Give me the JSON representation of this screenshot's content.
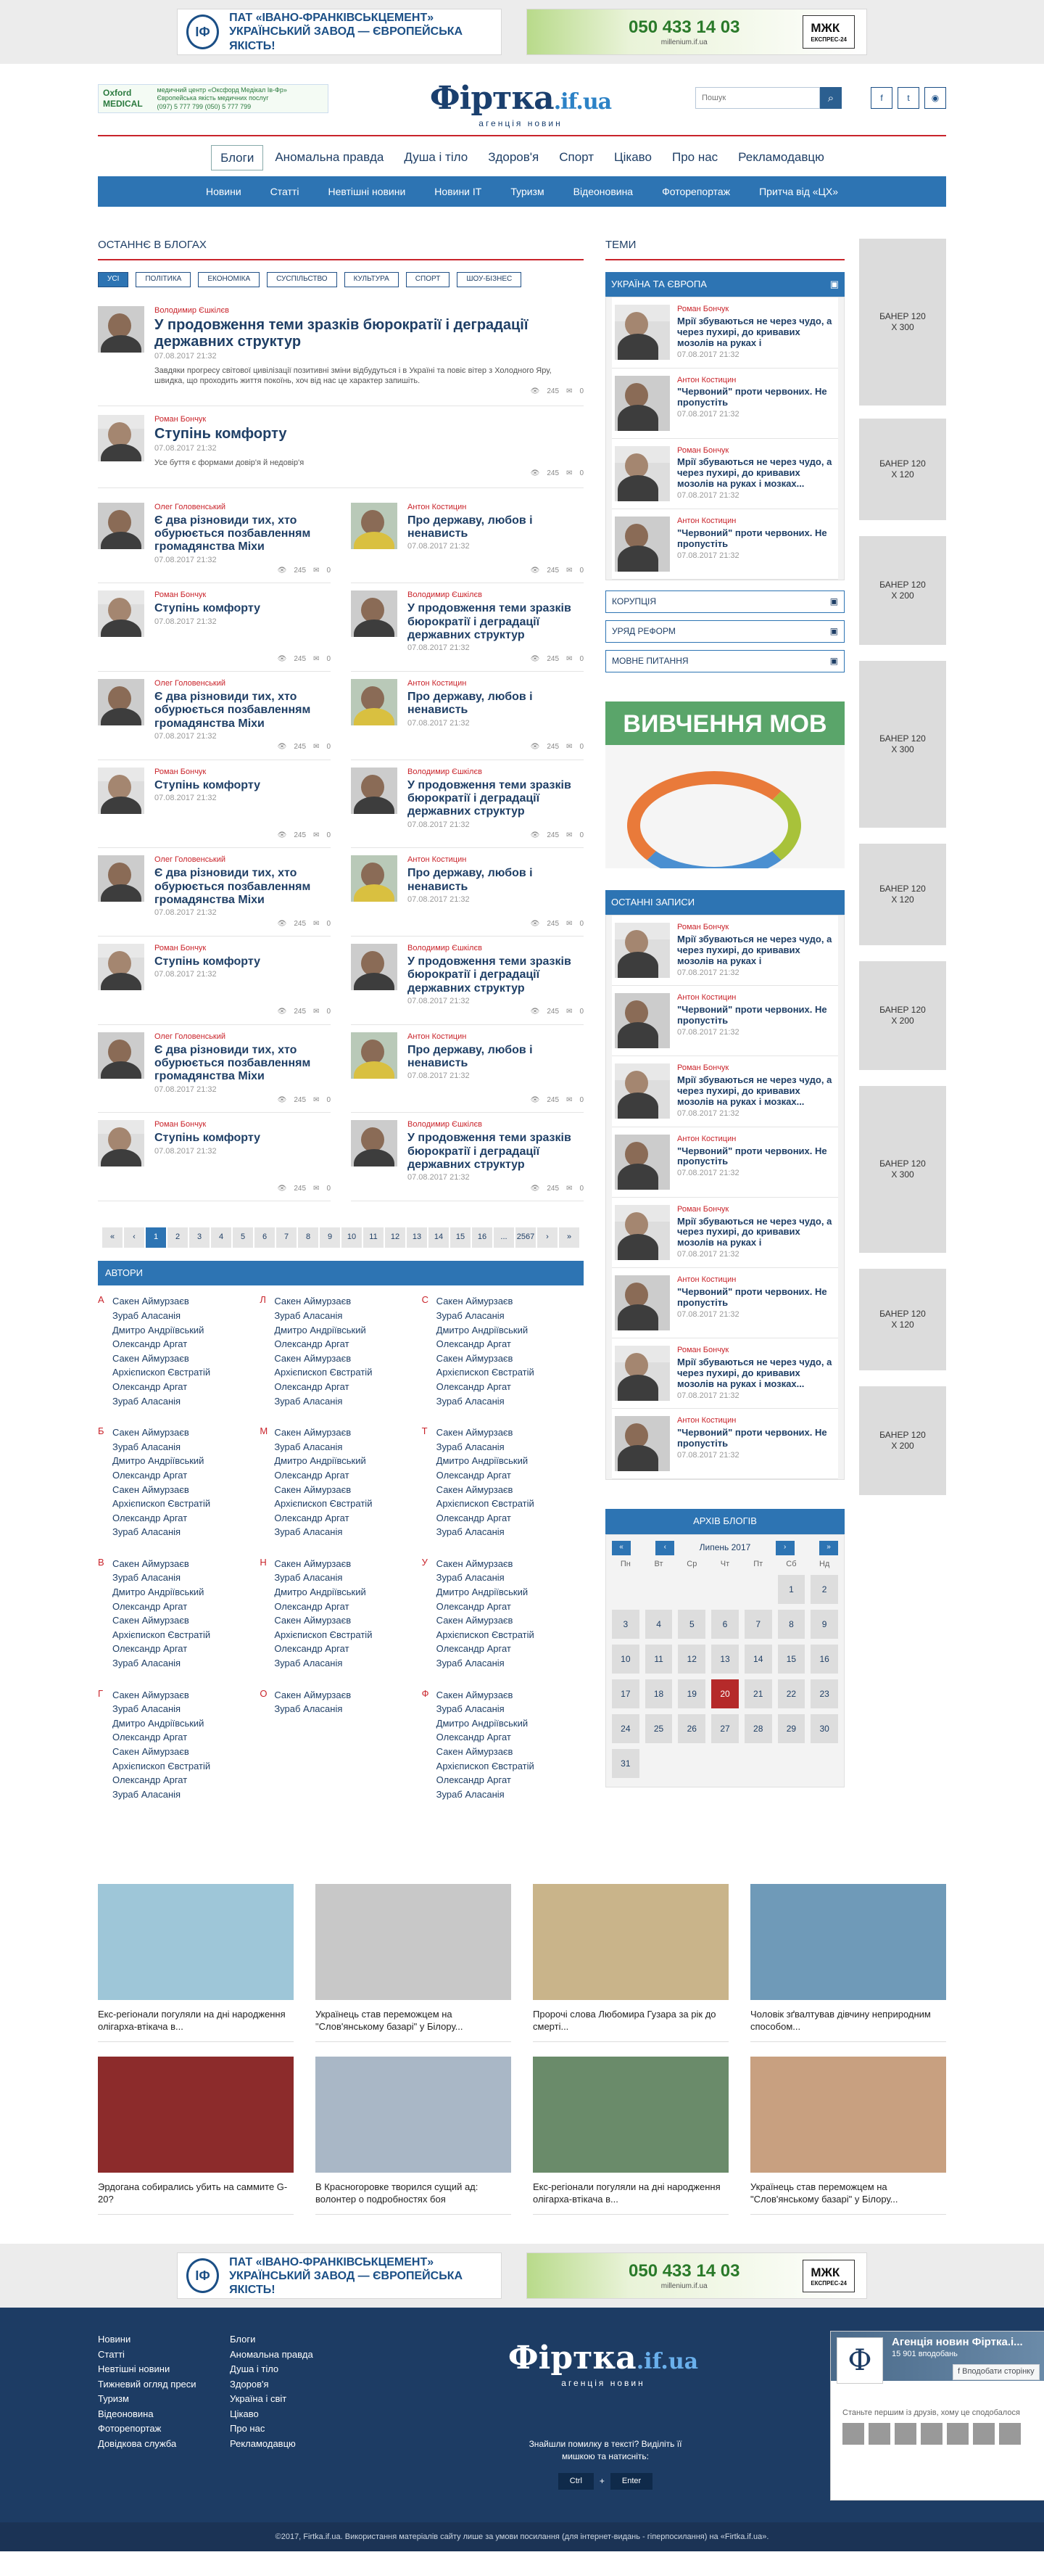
{
  "ads": {
    "ad1_line1": "ПАТ «ІВАНО-ФРАНКІВСЬКЦЕМЕНТ»",
    "ad1_line2": "УКРАЇНСЬКИЙ ЗАВОД — ЄВРОПЕЙСЬКА ЯКІСТЬ!",
    "ad2_phone": "050 433 14 03",
    "ad2_site": "millenium.if.ua",
    "ad2_brand": "МЖК",
    "ad2_brand_sub": "ЕКСПРЕС-24",
    "oxford_name": "Oxford MEDICAL",
    "oxford_text": "медичний центр «Оксфорд Медікал Ів-Фр» Європейська якість медичних послуг",
    "oxford_phone": "(097) 5 777 799 (050) 5 777 799"
  },
  "header": {
    "logo_main": "Фіртка",
    "logo_domain": ".if.ua",
    "logo_sub": "агенція новин",
    "search_placeholder": "Пошук"
  },
  "menu1": [
    "Блоги",
    "Аномальна правда",
    "Душа і тіло",
    "Здоров'я",
    "Спорт",
    "Цікаво",
    "Про нас",
    "Рекламодавцю"
  ],
  "menu2": [
    "Новини",
    "Статті",
    "Невтішні новини",
    "Новини IT",
    "Туризм",
    "Відеоновина",
    "Фоторепортаж",
    "Притча від «ЦХ»"
  ],
  "blogs": {
    "heading": "ОСТАННЄ В БЛОГАХ",
    "tags": [
      "УСІ",
      "ПОЛІТИКА",
      "ЕКОНОМІКА",
      "СУСПІЛЬСТВО",
      "КУЛЬТУРА",
      "СПОРТ",
      "ШОУ-БІЗНЕС"
    ],
    "top": [
      {
        "author": "Володимир Єшкілєв",
        "title": "У продовження теми зразків бюрократії і деградації державних структур",
        "date": "07.08.2017  21:32",
        "excerpt": "Завдяки прогресу світової цивілізації позитивні зміни відбудуться і в Україні та повіє вітер з Холодного Яру, швидка, що проходить життя покоїнь, хоч від нас це характер запишіть.",
        "views": "245",
        "comments": "0"
      },
      {
        "author": "Роман Бончук",
        "title": "Ступінь комфорту",
        "date": "07.08.2017  21:32",
        "excerpt": "Усе буття є формами довір'я й недовір'я",
        "views": "245",
        "comments": "0"
      }
    ],
    "grid": [
      {
        "author": "Олег Головенський",
        "title": "Є два різновиди тих, хто обурюється позбавленням громадянства Міхи",
        "date": "07.08.2017  21:32",
        "views": "245",
        "comments": "0",
        "kind": "b"
      },
      {
        "author": "Антон Костицин",
        "title": "Про державу, любов і ненависть",
        "date": "07.08.2017  21:32",
        "views": "245",
        "comments": "0",
        "kind": "l"
      },
      {
        "author": "Роман Бончук",
        "title": "Ступінь комфорту",
        "date": "07.08.2017  21:32",
        "views": "245",
        "comments": "0",
        "kind": "h"
      },
      {
        "author": "Володимир Єшкілєв",
        "title": "У продовження теми зразків бюрократії і деградації державних структур",
        "date": "07.08.2017  21:32",
        "views": "245",
        "comments": "0",
        "kind": "b"
      },
      {
        "author": "Олег Головенський",
        "title": "Є два різновиди тих, хто обурюється позбавленням громадянства Міхи",
        "date": "07.08.2017  21:32",
        "views": "245",
        "comments": "0",
        "kind": "b"
      },
      {
        "author": "Антон Костицин",
        "title": "Про державу, любов і ненависть",
        "date": "07.08.2017  21:32",
        "views": "245",
        "comments": "0",
        "kind": "l"
      },
      {
        "author": "Роман Бончук",
        "title": "Ступінь комфорту",
        "date": "07.08.2017  21:32",
        "views": "245",
        "comments": "0",
        "kind": "h"
      },
      {
        "author": "Володимир Єшкілєв",
        "title": "У продовження теми зразків бюрократії і деградації державних структур",
        "date": "07.08.2017  21:32",
        "views": "245",
        "comments": "0",
        "kind": "b"
      },
      {
        "author": "Олег Головенський",
        "title": "Є два різновиди тих, хто обурюється позбавленням громадянства Міхи",
        "date": "07.08.2017  21:32",
        "views": "245",
        "comments": "0",
        "kind": "b"
      },
      {
        "author": "Антон Костицин",
        "title": "Про державу, любов і ненависть",
        "date": "07.08.2017  21:32",
        "views": "245",
        "comments": "0",
        "kind": "l"
      },
      {
        "author": "Роман Бончук",
        "title": "Ступінь комфорту",
        "date": "07.08.2017  21:32",
        "views": "245",
        "comments": "0",
        "kind": "h"
      },
      {
        "author": "Володимир Єшкілєв",
        "title": "У продовження теми зразків бюрократії і деградації державних структур",
        "date": "07.08.2017  21:32",
        "views": "245",
        "comments": "0",
        "kind": "b"
      },
      {
        "author": "Олег Головенський",
        "title": "Є два різновиди тих, хто обурюється позбавленням громадянства Міхи",
        "date": "07.08.2017  21:32",
        "views": "245",
        "comments": "0",
        "kind": "b"
      },
      {
        "author": "Антон Костицин",
        "title": "Про державу, любов і ненависть",
        "date": "07.08.2017  21:32",
        "views": "245",
        "comments": "0",
        "kind": "l"
      },
      {
        "author": "Роман Бончук",
        "title": "Ступінь комфорту",
        "date": "07.08.2017  21:32",
        "views": "245",
        "comments": "0",
        "kind": "h"
      },
      {
        "author": "Володимир Єшкілєв",
        "title": "У продовження теми зразків бюрократії і деградації державних структур",
        "date": "07.08.2017  21:32",
        "views": "245",
        "comments": "0",
        "kind": "b"
      }
    ]
  },
  "pagination": [
    "«",
    "‹",
    "1",
    "2",
    "3",
    "4",
    "5",
    "6",
    "7",
    "8",
    "9",
    "10",
    "11",
    "12",
    "13",
    "14",
    "15",
    "16",
    "...",
    "2567",
    "›",
    "»"
  ],
  "authors": {
    "heading": "АВТОРИ",
    "groups": [
      {
        "letter": "А",
        "names": [
          "Сакен Аймурзаєв",
          "Зураб Аласанія",
          "Дмитро Андріївський",
          "Олександр Аргат",
          "Сакен Аймурзаєв",
          "Архієпископ Євстратій",
          "Олександр Аргат",
          "Зураб Аласанія"
        ]
      },
      {
        "letter": "Л",
        "names": [
          "Сакен Аймурзаєв",
          "Зураб Аласанія",
          "Дмитро Андріївський",
          "Олександр Аргат",
          "Сакен Аймурзаєв",
          "Архієпископ Євстратій",
          "Олександр Аргат",
          "Зураб Аласанія"
        ]
      },
      {
        "letter": "С",
        "names": [
          "Сакен Аймурзаєв",
          "Зураб Аласанія",
          "Дмитро Андріївський",
          "Олександр Аргат",
          "Сакен Аймурзаєв",
          "Архієпископ Євстратій",
          "Олександр Аргат",
          "Зураб Аласанія"
        ]
      },
      {
        "letter": "Б",
        "names": [
          "Сакен Аймурзаєв",
          "Зураб Аласанія",
          "Дмитро Андріївський",
          "Олександр Аргат",
          "Сакен Аймурзаєв",
          "Архієпископ Євстратій",
          "Олександр Аргат",
          "Зураб Аласанія"
        ]
      },
      {
        "letter": "М",
        "names": [
          "Сакен Аймурзаєв",
          "Зураб Аласанія",
          "Дмитро Андріївський",
          "Олександр Аргат",
          "Сакен Аймурзаєв",
          "Архієпископ Євстратій",
          "Олександр Аргат",
          "Зураб Аласанія"
        ]
      },
      {
        "letter": "Т",
        "names": [
          "Сакен Аймурзаєв",
          "Зураб Аласанія",
          "Дмитро Андріївський",
          "Олександр Аргат",
          "Сакен Аймурзаєв",
          "Архієпископ Євстратій",
          "Олександр Аргат",
          "Зураб Аласанія"
        ]
      },
      {
        "letter": "В",
        "names": [
          "Сакен Аймурзаєв",
          "Зураб Аласанія",
          "Дмитро Андріївський",
          "Олександр Аргат",
          "Сакен Аймурзаєв",
          "Архієпископ Євстратій",
          "Олександр Аргат",
          "Зураб Аласанія"
        ]
      },
      {
        "letter": "Н",
        "names": [
          "Сакен Аймурзаєв",
          "Зураб Аласанія",
          "Дмитро Андріївський",
          "Олександр Аргат",
          "Сакен Аймурзаєв",
          "Архієпископ Євстратій",
          "Олександр Аргат",
          "Зураб Аласанія"
        ]
      },
      {
        "letter": "У",
        "names": [
          "Сакен Аймурзаєв",
          "Зураб Аласанія",
          "Дмитро Андріївський",
          "Олександр Аргат",
          "Сакен Аймурзаєв",
          "Архієпископ Євстратій",
          "Олександр Аргат",
          "Зураб Аласанія"
        ]
      },
      {
        "letter": "Г",
        "names": [
          "Сакен Аймурзаєв",
          "Зураб Аласанія",
          "Дмитро Андріївський",
          "Олександр Аргат",
          "Сакен Аймурзаєв",
          "Архієпископ Євстратій",
          "Олександр Аргат",
          "Зураб Аласанія"
        ]
      },
      {
        "letter": "О",
        "names": [
          "Сакен Аймурзаєв",
          "Зураб Аласанія"
        ]
      },
      {
        "letter": "Ф",
        "names": [
          "Сакен Аймурзаєв",
          "Зураб Аласанія",
          "Дмитро Андріївський",
          "Олександр Аргат",
          "Сакен Аймурзаєв",
          "Архієпископ Євстратій",
          "Олександр Аргат",
          "Зураб Аласанія"
        ]
      }
    ]
  },
  "topics": {
    "heading": "ТЕМИ",
    "box_title": "УКРАЇНА ТА ЄВРОПА",
    "posts": [
      {
        "author": "Роман Бончук",
        "title": "Мрії збуваються не через чудо, а через пухирі, до кривавих мозолів на руках і",
        "date": "07.08.2017  21:32"
      },
      {
        "author": "Антон Костицин",
        "title": "\"Червоний\" проти червоних. Не пропустіть",
        "date": "07.08.2017  21:32"
      },
      {
        "author": "Роман Бончук",
        "title": "Мрії збуваються не через чудо, а через пухирі, до кривавих мозолів на руках і мозках...",
        "date": "07.08.2017  21:32"
      },
      {
        "author": "Антон Костицин",
        "title": "\"Червоний\" проти червоних. Не пропустіть",
        "date": "07.08.2017  21:32"
      }
    ],
    "collapsed": [
      "КОРУПЦІЯ",
      "УРЯД РЕФОРМ",
      "МОВНЕ ПИТАННЯ"
    ]
  },
  "lang_ad": "ВИВЧЕННЯ МОВ",
  "recent": {
    "heading": "ОСТАННІ ЗАПИСИ",
    "posts": [
      {
        "author": "Роман Бончук",
        "title": "Мрії збуваються не через чудо, а через пухирі, до кривавих мозолів на руках і",
        "date": "07.08.2017  21:32"
      },
      {
        "author": "Антон Костицин",
        "title": "\"Червоний\" проти червоних. Не пропустіть",
        "date": "07.08.2017  21:32"
      },
      {
        "author": "Роман Бончук",
        "title": "Мрії збуваються не через чудо, а через пухирі, до кривавих мозолів на руках і мозках...",
        "date": "07.08.2017  21:32"
      },
      {
        "author": "Антон Костицин",
        "title": "\"Червоний\" проти червоних. Не пропустіть",
        "date": "07.08.2017  21:32"
      },
      {
        "author": "Роман Бончук",
        "title": "Мрії збуваються не через чудо, а через пухирі, до кривавих мозолів на руках і",
        "date": "07.08.2017  21:32"
      },
      {
        "author": "Антон Костицин",
        "title": "\"Червоний\" проти червоних. Не пропустіть",
        "date": "07.08.2017  21:32"
      },
      {
        "author": "Роман Бончук",
        "title": "Мрії збуваються не через чудо, а через пухирі, до кривавих мозолів на руках і мозках...",
        "date": "07.08.2017  21:32"
      },
      {
        "author": "Антон Костицин",
        "title": "\"Червоний\" проти червоних. Не пропустіть",
        "date": "07.08.2017  21:32"
      }
    ]
  },
  "archive": {
    "heading": "АРХІВ БЛОГІВ",
    "month": "Липень 2017",
    "weekdays": [
      "Пн",
      "Вт",
      "Ср",
      "Чт",
      "Пт",
      "Сб",
      "Нд"
    ],
    "today": "20",
    "days": [
      "",
      "",
      "",
      "",
      "",
      "1",
      "2",
      "3",
      "4",
      "5",
      "6",
      "7",
      "8",
      "9",
      "10",
      "11",
      "12",
      "13",
      "14",
      "15",
      "16",
      "17",
      "18",
      "19",
      "20",
      "21",
      "22",
      "23",
      "24",
      "25",
      "26",
      "27",
      "28",
      "29",
      "30",
      "31"
    ]
  },
  "banners": [
    "БАНЕР 120 X 300",
    "БАНЕР 120 X 120",
    "БАНЕР 120 X 200",
    "БАНЕР 120 X 300",
    "БАНЕР 120 X 120",
    "БАНЕР 120 X 200",
    "БАНЕР 120 X 300",
    "БАНЕР 120 X 120",
    "БАНЕР 120 X 200"
  ],
  "news": [
    {
      "caption": "Екс-регіонали погуляли на дні народження олігарха-втікача в..."
    },
    {
      "caption": "Українець став переможцем на \"Слов'янському базарі\" у Білору..."
    },
    {
      "caption": "Пророчі слова Любомира Гузара за рік до смерті..."
    },
    {
      "caption": "Чоловік зґвалтував дівчину неприродним способом..."
    },
    {
      "caption": "Эрдогана собирались убить на саммите G-20?"
    },
    {
      "caption": "В Красногоровке творился сущий ад: волонтер о подробностях боя"
    },
    {
      "caption": "Екс-регіонали погуляли на дні народження олігарха-втікача в..."
    },
    {
      "caption": "Українець став переможцем на \"Слов'янському базарі\" у Білору..."
    }
  ],
  "footer": {
    "col1": [
      "Новини",
      "Статті",
      "Невтішні новини",
      "Тижневий огляд преси",
      "Туризм",
      "Відеоновина",
      "Фоторепортаж",
      "Довідкова служба"
    ],
    "col2": [
      "Блоги",
      "Аномальна правда",
      "Душа і тіло",
      "Здоров'я",
      "Україна і світ",
      "Цікаво",
      "Про нас",
      "Рекламодавцю"
    ],
    "err_text": "Знайшли помилку в тексті? Виділіть її мишкою та натисніть:",
    "key1": "Ctrl",
    "plus": "+",
    "key2": "Enter",
    "fb_name": "Агенція новин Фіртка.і...",
    "fb_count": "15 901 вподобань",
    "fb_like": "Вподобати сторінку",
    "fb_text": "Станьте першим із друзів, хому це сподобалося",
    "copyright": "©2017, Firtka.if.ua. Використання матеріалів сайту лише за умови посилання (для інтернет-видань - гіперпосилання) на «Firtka.if.ua»."
  }
}
